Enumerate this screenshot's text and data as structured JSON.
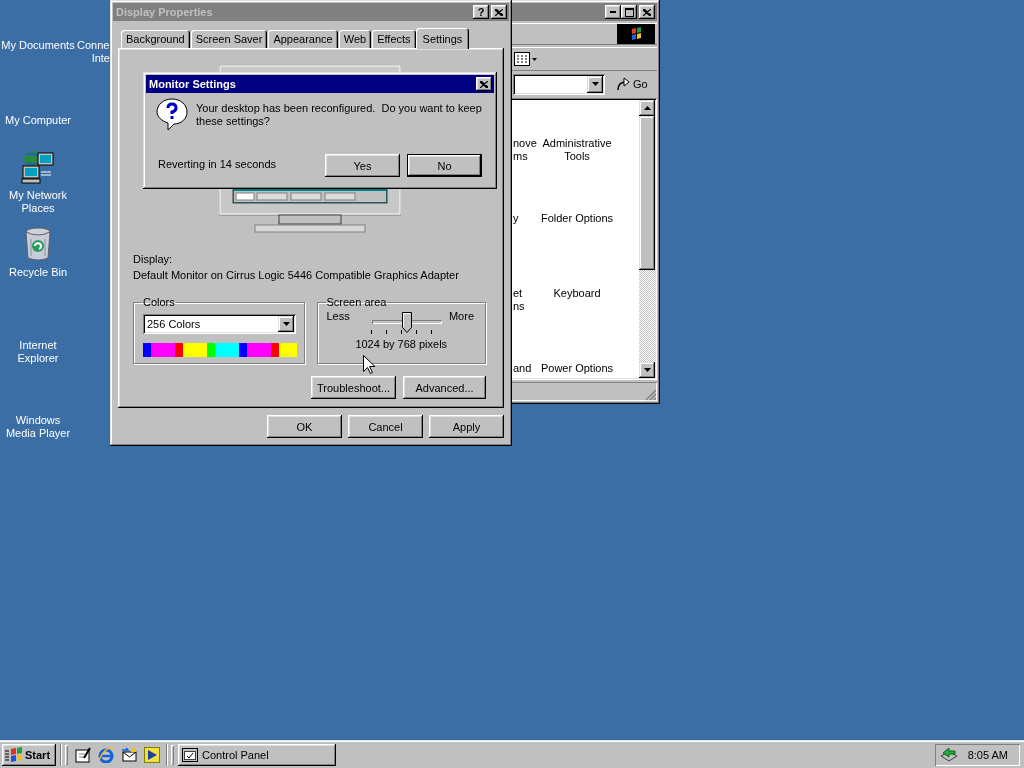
{
  "desktop": {
    "icons": [
      {
        "label": "My Documents",
        "kind": "plain"
      },
      {
        "label": "My Computer",
        "kind": "plain"
      },
      {
        "label": "My Network Places",
        "kind": "network"
      },
      {
        "label": "Recycle Bin",
        "kind": "bin"
      },
      {
        "label": "Internet Explorer",
        "kind": "plain"
      },
      {
        "label": "Windows Media Player",
        "kind": "plain"
      }
    ],
    "cut_label": [
      "Conne",
      "Inte"
    ]
  },
  "control_panel_window": {
    "active": false,
    "go": "Go",
    "items": [
      {
        "cut_lines": [
          "nove",
          "ms"
        ],
        "label": "Administrative Tools"
      },
      {
        "cut_lines": [
          "y"
        ],
        "label": "Folder Options"
      },
      {
        "cut_lines": [
          "et",
          "ns"
        ],
        "label": "Keyboard"
      },
      {
        "cut_lines": [
          "and"
        ],
        "label": "Power Options"
      }
    ]
  },
  "display_properties": {
    "title": "Display Properties",
    "active": false,
    "help_button": "?",
    "tabs": [
      {
        "label": "Background",
        "selected": false
      },
      {
        "label": "Screen Saver",
        "selected": false
      },
      {
        "label": "Appearance",
        "selected": false
      },
      {
        "label": "Web",
        "selected": false
      },
      {
        "label": "Effects",
        "selected": false
      },
      {
        "label": "Settings",
        "selected": true
      }
    ],
    "display_label": "Display:",
    "display_name": "Default Monitor on Cirrus Logic 5446 Compatible Graphics Adapter",
    "colors": {
      "label": "Colors",
      "value": "256 Colors"
    },
    "screen_area": {
      "label": "Screen area",
      "min_label": "Less",
      "max_label": "More",
      "level": 0.5,
      "reading": "1024 by 768 pixels"
    },
    "panel_buttons": [
      "Troubleshoot...",
      "Advanced..."
    ],
    "buttons": [
      "OK",
      "Cancel",
      "Apply"
    ]
  },
  "monitor_settings": {
    "title": "Monitor Settings",
    "active": true,
    "message": "Your desktop has been reconfigured.  Do you want to keep these settings?",
    "countdown": "Reverting in 14 seconds",
    "buttons": [
      {
        "label": "Yes",
        "default": false
      },
      {
        "label": "No",
        "default": true
      }
    ]
  },
  "taskbar": {
    "start": "Start",
    "tasks": [
      {
        "label": "Control Panel",
        "selected": false
      }
    ],
    "clock": "8:05 AM"
  }
}
